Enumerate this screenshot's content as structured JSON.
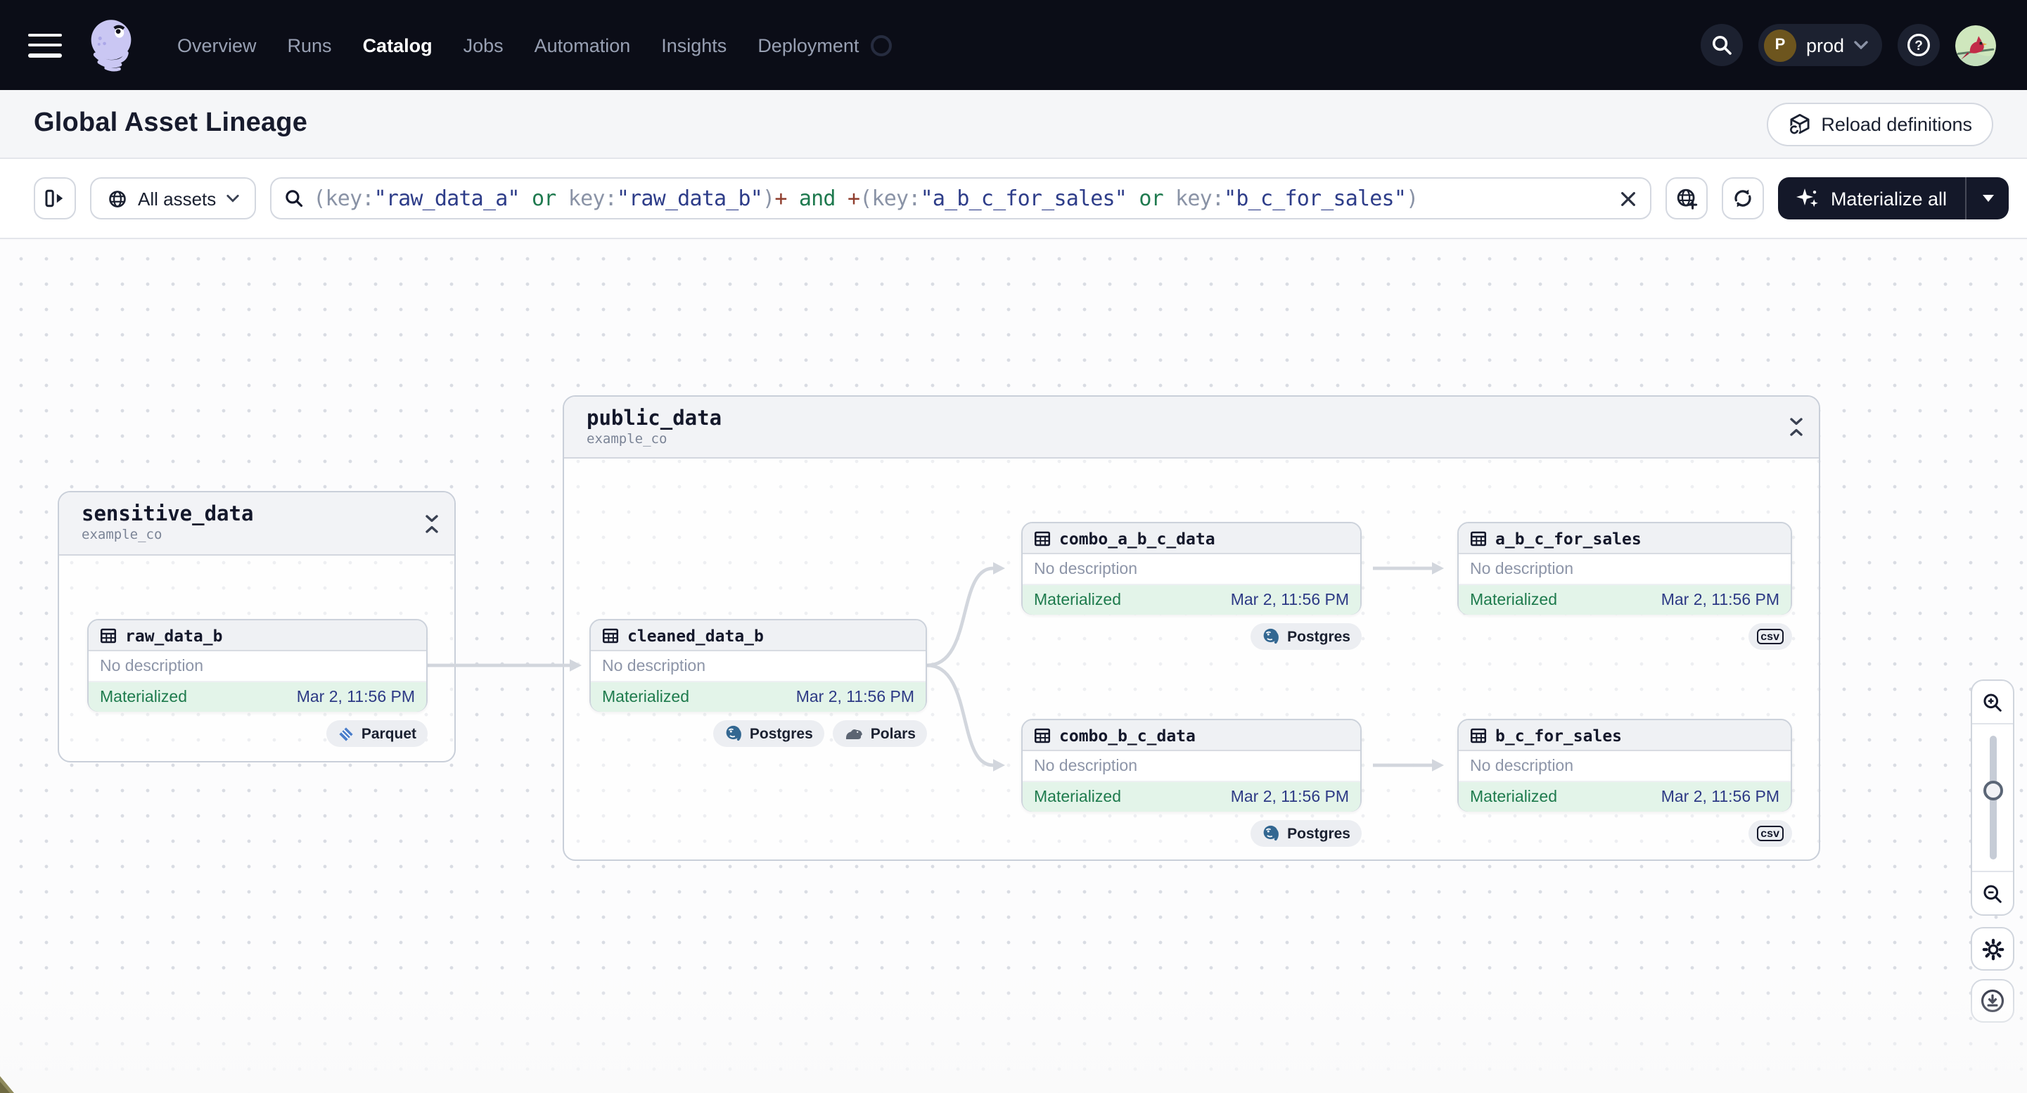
{
  "nav": {
    "items": [
      "Overview",
      "Runs",
      "Catalog",
      "Jobs",
      "Automation",
      "Insights",
      "Deployment"
    ],
    "active_item": "Catalog",
    "deployment_switcher": {
      "initial": "P",
      "label": "prod"
    }
  },
  "header": {
    "title": "Global Asset Lineage",
    "reload_label": "Reload definitions"
  },
  "toolbar": {
    "scope_label": "All assets",
    "materialize_label": "Materialize all",
    "query": {
      "segments": [
        {
          "t": "(key:",
          "c": "syntax"
        },
        {
          "t": "\"raw_data_a\"",
          "c": "value"
        },
        {
          "t": " ",
          "c": "syntax"
        },
        {
          "t": "or",
          "c": "keyword"
        },
        {
          "t": " key:",
          "c": "syntax"
        },
        {
          "t": "\"raw_data_b\"",
          "c": "value"
        },
        {
          "t": ")",
          "c": "syntax"
        },
        {
          "t": "+",
          "c": "operator"
        },
        {
          "t": " ",
          "c": "syntax"
        },
        {
          "t": "and",
          "c": "keyword"
        },
        {
          "t": " ",
          "c": "syntax"
        },
        {
          "t": "+",
          "c": "operator"
        },
        {
          "t": "(key:",
          "c": "syntax"
        },
        {
          "t": "\"a_b_c_for_sales\"",
          "c": "value"
        },
        {
          "t": " ",
          "c": "syntax"
        },
        {
          "t": "or",
          "c": "keyword"
        },
        {
          "t": " key:",
          "c": "syntax"
        },
        {
          "t": "\"b_c_for_sales\"",
          "c": "value"
        },
        {
          "t": ")",
          "c": "syntax"
        }
      ]
    }
  },
  "lineage": {
    "groups": {
      "sensitive_data": {
        "name": "sensitive_data",
        "location": "example_co"
      },
      "public_data": {
        "name": "public_data",
        "location": "example_co"
      }
    },
    "assets": {
      "raw_data_b": {
        "name": "raw_data_b",
        "description": "No description",
        "status": "Materialized",
        "materialized_at": "Mar 2, 11:56 PM",
        "tags": [
          "Parquet"
        ]
      },
      "cleaned_data_b": {
        "name": "cleaned_data_b",
        "description": "No description",
        "status": "Materialized",
        "materialized_at": "Mar 2, 11:56 PM",
        "tags": [
          "Postgres",
          "Polars"
        ]
      },
      "combo_a_b_c_data": {
        "name": "combo_a_b_c_data",
        "description": "No description",
        "status": "Materialized",
        "materialized_at": "Mar 2, 11:56 PM",
        "tags": [
          "Postgres"
        ]
      },
      "a_b_c_for_sales": {
        "name": "a_b_c_for_sales",
        "description": "No description",
        "status": "Materialized",
        "materialized_at": "Mar 2, 11:56 PM",
        "tags": [
          "csv"
        ]
      },
      "combo_b_c_data": {
        "name": "combo_b_c_data",
        "description": "No description",
        "status": "Materialized",
        "materialized_at": "Mar 2, 11:56 PM",
        "tags": [
          "Postgres"
        ]
      },
      "b_c_for_sales": {
        "name": "b_c_for_sales",
        "description": "No description",
        "status": "Materialized",
        "materialized_at": "Mar 2, 11:56 PM",
        "tags": [
          "csv"
        ]
      }
    }
  },
  "colors": {
    "nav_bg": "#0b0d17",
    "brand_lavender": "#cac7f3",
    "materialized_text": "#1e7b4d",
    "materialized_bg": "#e3f4e9",
    "timestamp_text": "#2d3a85",
    "query_syntax": "#8a93a6",
    "query_value": "#2e3d89",
    "query_keyword": "#1f7a4f",
    "query_operator": "#8f3e2e",
    "dark_button_bg": "#141829"
  }
}
